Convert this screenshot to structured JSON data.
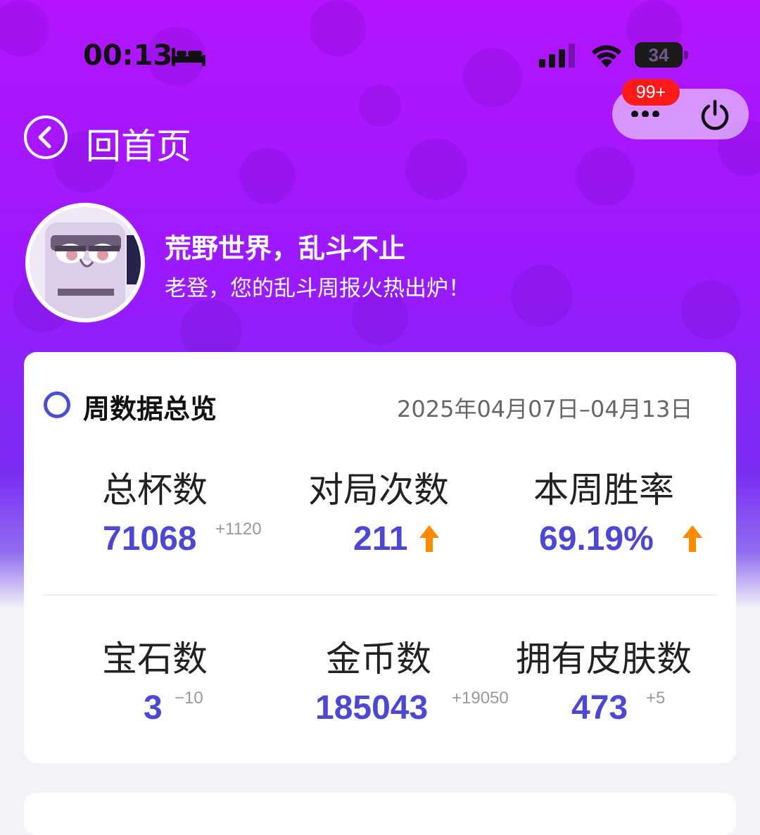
{
  "status_bar": {
    "time": "00:13",
    "battery": "34",
    "icons": [
      "bed-icon",
      "signal-icon",
      "wifi-icon",
      "battery-icon"
    ]
  },
  "nav": {
    "back_label": "回首页",
    "badge": "99+",
    "icons": [
      "back-chevron-icon",
      "more-icon",
      "power-icon"
    ]
  },
  "profile": {
    "title": "荒野世界，乱斗不止",
    "subtitle": "老登，您的乱斗周报火热出炉！"
  },
  "overview": {
    "title": "周数据总览",
    "date_range": "2025年04月07日–04月13日",
    "stats": [
      {
        "label": "总杯数",
        "value": "71068",
        "delta": "+1120"
      },
      {
        "label": "对局次数",
        "value": "211",
        "trend": "up"
      },
      {
        "label": "本周胜率",
        "value": "69.19%",
        "trend": "up"
      },
      {
        "label": "宝石数",
        "value": "3",
        "delta": "−10"
      },
      {
        "label": "金币数",
        "value": "185043",
        "delta": "+19050"
      },
      {
        "label": "拥有皮肤数",
        "value": "473",
        "delta": "+5"
      }
    ]
  },
  "colors": {
    "header_top": "#b414ff",
    "header_mid": "#7a2cf2",
    "accent": "#4d47d6",
    "up_arrow": "#ff8a00",
    "badge": "#ff1a1a"
  }
}
